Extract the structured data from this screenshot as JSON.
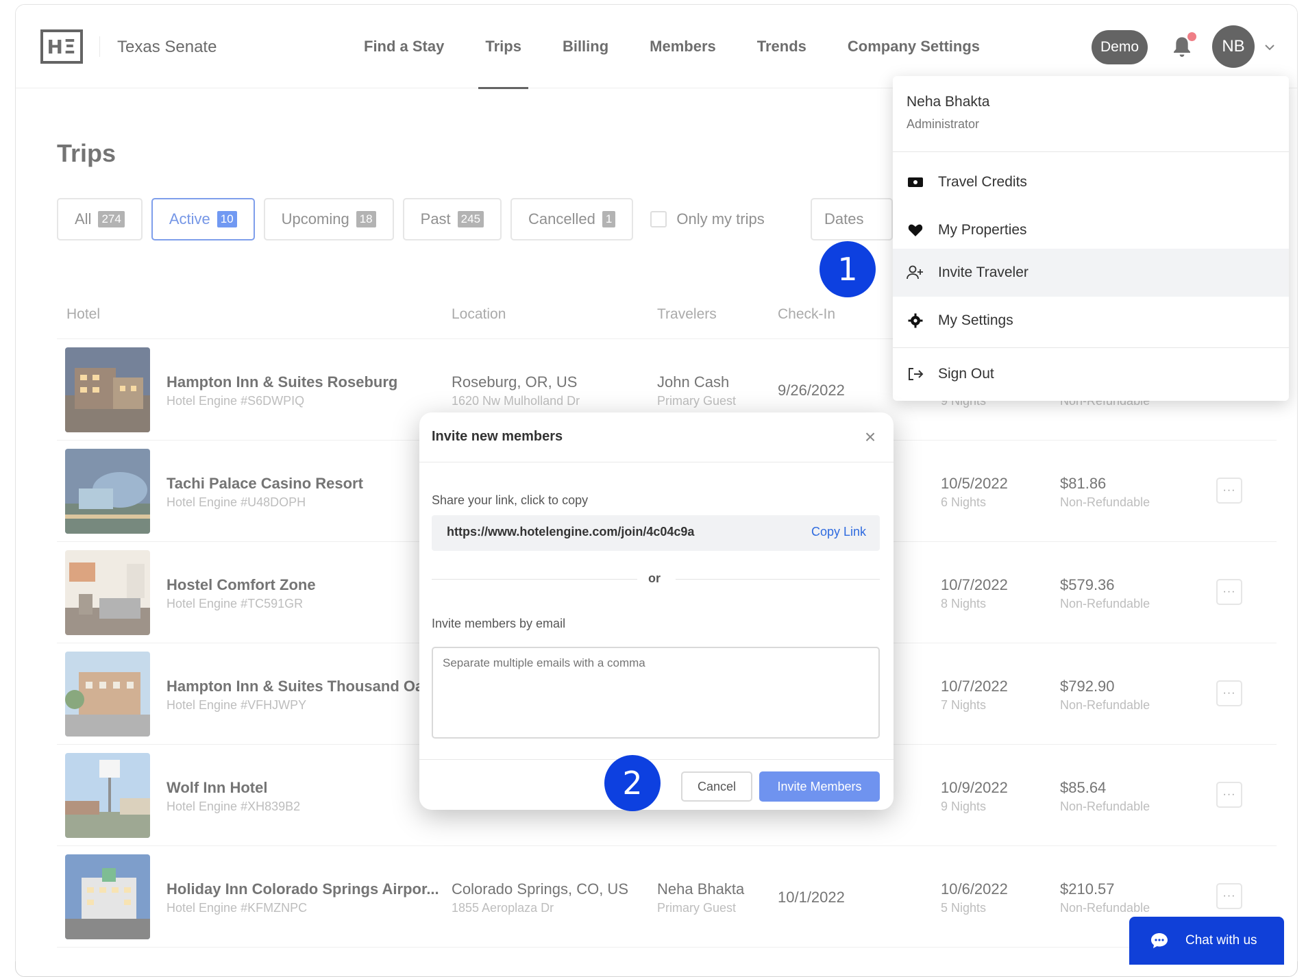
{
  "header": {
    "logo_text": "HΞ",
    "company": "Texas Senate",
    "nav": [
      "Find a Stay",
      "Trips",
      "Billing",
      "Members",
      "Trends",
      "Company Settings"
    ],
    "demo_label": "Demo",
    "avatar_initials": "NB"
  },
  "page": {
    "title": "Trips",
    "filters": [
      {
        "label": "All",
        "count": "274"
      },
      {
        "label": "Active",
        "count": "10"
      },
      {
        "label": "Upcoming",
        "count": "18"
      },
      {
        "label": "Past",
        "count": "245"
      },
      {
        "label": "Cancelled",
        "count": "1"
      }
    ],
    "only_my_trips": "Only my trips",
    "dates_label": "Dates"
  },
  "table": {
    "headers": {
      "hotel": "Hotel",
      "location": "Location",
      "travelers": "Travelers",
      "checkin": "Check-In"
    },
    "rows": [
      {
        "name": "Hampton Inn & Suites Roseburg",
        "id": "Hotel Engine #S6DWPIQ",
        "city": "Roseburg, OR, US",
        "address": "1620 Nw Mulholland Dr",
        "traveler": "John Cash",
        "role": "Primary Guest",
        "checkin": "9/26/2022",
        "checkout": "",
        "nights": "9 Nights",
        "price": "",
        "refund": "Non-Refundable"
      },
      {
        "name": "Tachi Palace Casino Resort",
        "id": "Hotel Engine #U48DOPH",
        "city": "",
        "address": "",
        "traveler": "",
        "role": "",
        "checkin": "",
        "checkout": "10/5/2022",
        "nights": "6 Nights",
        "price": "$81.86",
        "refund": "Non-Refundable"
      },
      {
        "name": "Hostel Comfort Zone",
        "id": "Hotel Engine #TC591GR",
        "city": "",
        "address": "",
        "traveler": "",
        "role": "",
        "checkin": "",
        "checkout": "10/7/2022",
        "nights": "8 Nights",
        "price": "$579.36",
        "refund": "Non-Refundable"
      },
      {
        "name": "Hampton Inn & Suites Thousand Oa...",
        "id": "Hotel Engine #VFHJWPY",
        "city": "",
        "address": "",
        "traveler": "",
        "role": "",
        "checkin": "",
        "checkout": "10/7/2022",
        "nights": "7 Nights",
        "price": "$792.90",
        "refund": "Non-Refundable"
      },
      {
        "name": "Wolf Inn Hotel",
        "id": "Hotel Engine #XH839B2",
        "city": "",
        "address": "",
        "traveler": "",
        "role": "",
        "checkin": "",
        "checkout": "10/9/2022",
        "nights": "9 Nights",
        "price": "$85.64",
        "refund": "Non-Refundable"
      },
      {
        "name": "Holiday Inn Colorado Springs Airpor...",
        "id": "Hotel Engine #KFMZNPC",
        "city": "Colorado Springs, CO, US",
        "address": "1855 Aeroplaza Dr",
        "traveler": "Neha Bhakta",
        "role": "Primary Guest",
        "checkin": "10/1/2022",
        "checkout": "10/6/2022",
        "nights": "5 Nights",
        "price": "$210.57",
        "refund": "Non-Refundable"
      }
    ],
    "more_label": "···"
  },
  "dropdown": {
    "user_name": "Neha Bhakta",
    "user_role": "Administrator",
    "items": [
      "Travel Credits",
      "My Properties",
      "Invite Traveler",
      "My Settings",
      "Sign Out"
    ]
  },
  "modal": {
    "title": "Invite new members",
    "close": "×",
    "share_label": "Share your link, click to copy",
    "link": "https://www.hotelengine.com/join/4c04c9a",
    "copy_link": "Copy Link",
    "or": "or",
    "email_label": "Invite members by email",
    "email_placeholder": "Separate multiple emails with a comma",
    "cancel": "Cancel",
    "invite": "Invite Members"
  },
  "steps": [
    "1",
    "2"
  ],
  "chat": {
    "label": "Chat with us"
  },
  "colors": {
    "accent": "#2563eb",
    "step_badge": "#0d40e0",
    "chat": "#1040d8",
    "invite_button": "#6f93ef",
    "notification_dot": "#e63946"
  }
}
